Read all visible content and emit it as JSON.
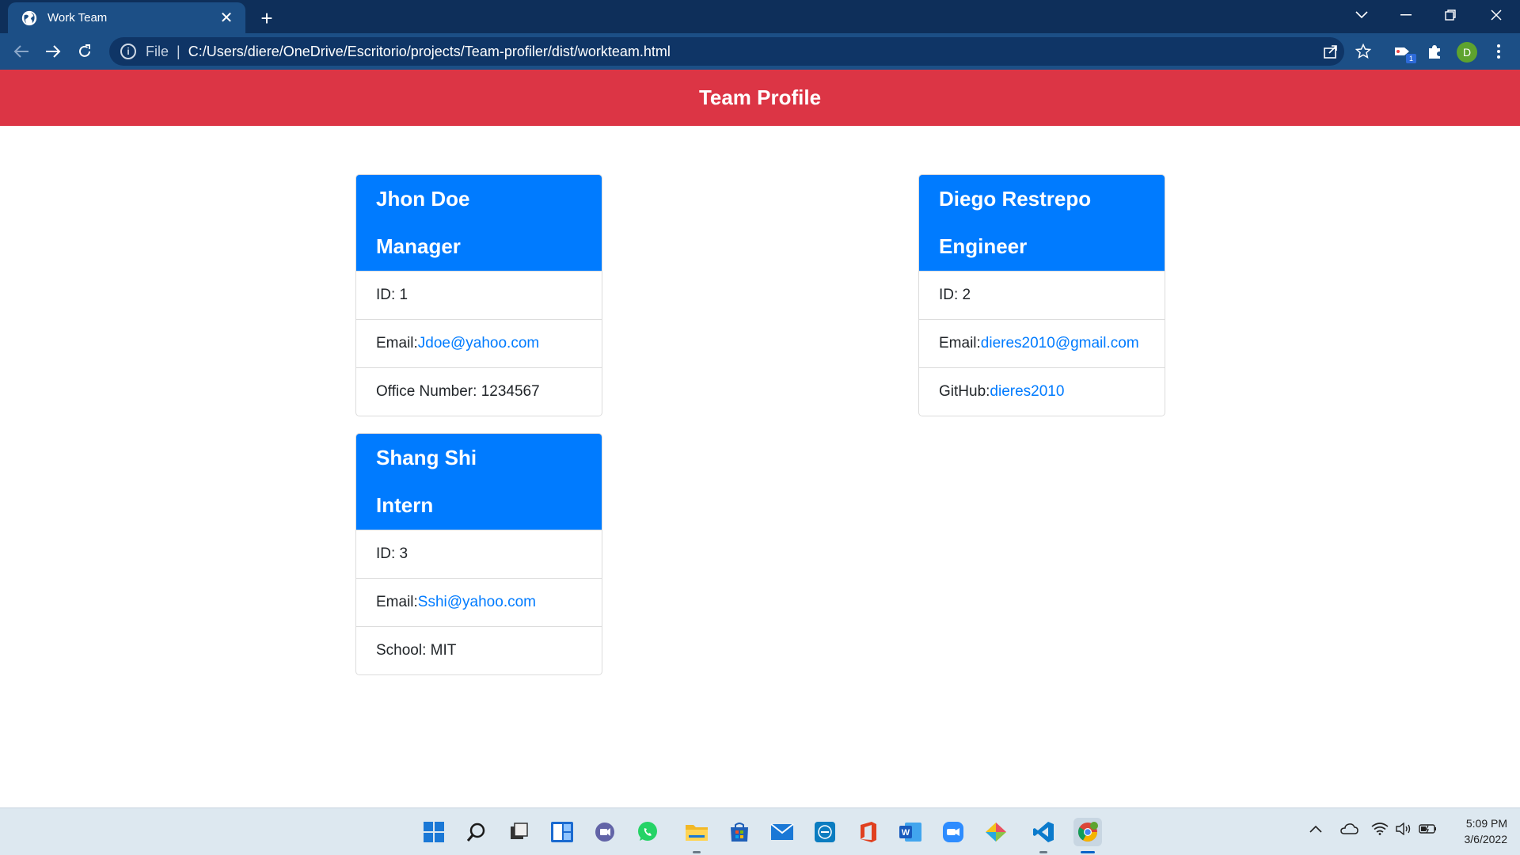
{
  "browser": {
    "tab_title": "Work Team",
    "tab_close": "✕",
    "new_tab": "+",
    "address_scheme": "File",
    "address_url": "C:/Users/diere/OneDrive/Escritorio/projects/Team-profiler/dist/workteam.html",
    "profile_initial": "D",
    "extension_badge": "1"
  },
  "page": {
    "title": "Team Profile"
  },
  "team": [
    {
      "name": "Jhon Doe",
      "role": "Manager",
      "id_label": "ID: 1",
      "email_label": "Email:",
      "email": "Jdoe@yahoo.com",
      "extra_label": "Office Number: 1234567",
      "extra_link": ""
    },
    {
      "name": "Diego Restrepo",
      "role": "Engineer",
      "id_label": "ID: 2",
      "email_label": "Email:",
      "email": "dieres2010@gmail.com",
      "extra_label": "GitHub:",
      "extra_link": "dieres2010"
    },
    {
      "name": "Shang Shi",
      "role": "Intern",
      "id_label": "ID: 3",
      "email_label": "Email:",
      "email": "Sshi@yahoo.com",
      "extra_label": "School: MIT",
      "extra_link": ""
    }
  ],
  "taskbar": {
    "time": "5:09 PM",
    "date": "3/6/2022"
  },
  "colors": {
    "header": "#dc3545",
    "card_head": "#007bff",
    "link": "#007bff",
    "chrome_dark": "#0e2f5a",
    "chrome_toolbar": "#1c4f86"
  }
}
